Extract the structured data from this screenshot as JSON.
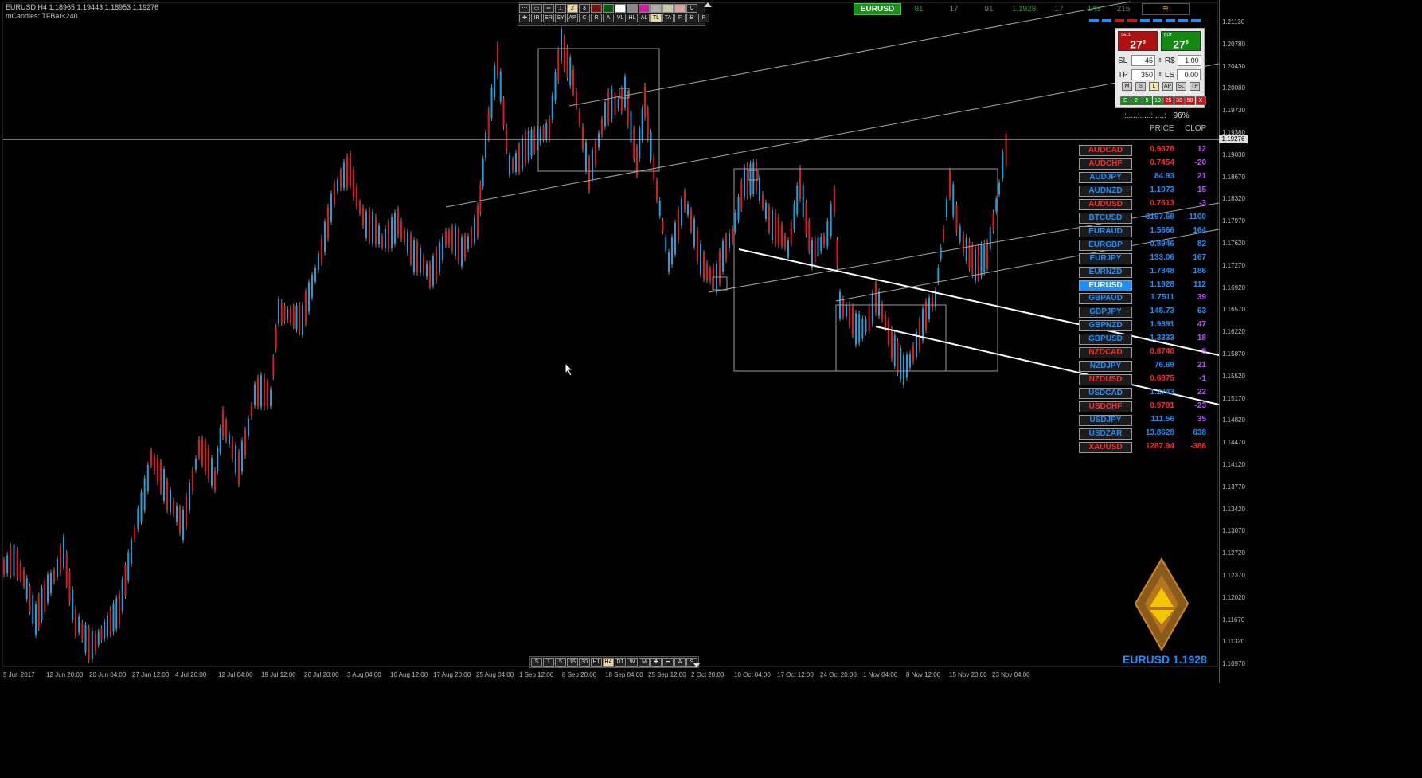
{
  "header": {
    "symbol_info": "EURUSD,H4  1.18965 1.19443 1.18953 1.19276",
    "indicator": "mCandles: TFBar<240"
  },
  "y_axis": [
    "1.21130",
    "1.20780",
    "1.20430",
    "1.20080",
    "1.19730",
    "1.19380",
    "1.19030",
    "1.18670",
    "1.18320",
    "1.17970",
    "1.17620",
    "1.17270",
    "1.16920",
    "1.16570",
    "1.16220",
    "1.15870",
    "1.15520",
    "1.15170",
    "1.14820",
    "1.14470",
    "1.14120",
    "1.13770",
    "1.13420",
    "1.13070",
    "1.12720",
    "1.12370",
    "1.12020",
    "1.11670",
    "1.11320",
    "1.10970"
  ],
  "current_price_label": "1.19276",
  "x_axis": [
    "5 Jun 2017",
    "12 Jun 20:00",
    "20 Jun 04:00",
    "27 Jun 12:00",
    "4 Jul 20:00",
    "12 Jul 04:00",
    "19 Jul 12:00",
    "26 Jul 20:00",
    "3 Aug 04:00",
    "10 Aug 12:00",
    "17 Aug 20:00",
    "25 Aug 04:00",
    "1 Sep 12:00",
    "8 Sep 20:00",
    "18 Sep 04:00",
    "25 Sep 12:00",
    "2 Oct 20:00",
    "10 Oct 04:00",
    "17 Oct 12:00",
    "24 Oct 20:00",
    "1 Nov 04:00",
    "8 Nov 12:00",
    "15 Nov 20:00",
    "23 Nov 04:00"
  ],
  "top_toolbar": {
    "row1": [
      "⋯",
      "▭",
      "═",
      "1",
      "2",
      "3"
    ],
    "row2": [
      "✚",
      "IR",
      "ER",
      "SY",
      "AP",
      "C",
      "R",
      "A",
      "VL",
      "HL",
      "AL",
      "TL",
      "TA",
      "F",
      "B",
      "P"
    ],
    "colors": [
      "#7a1010",
      "#0b5b0b",
      "#ffffff",
      "#888888",
      "#d020a0",
      "#aaaaaa",
      "#c8c8a0",
      "#d8a0a0"
    ],
    "right_btn": "C"
  },
  "bottom_toolbar": [
    "S",
    "1",
    "5",
    "15",
    "30",
    "H1",
    "H4",
    "D1",
    "W",
    "M",
    "✚",
    "━",
    "A",
    "S"
  ],
  "top_strip": {
    "pair": "EURUSD",
    "v1": "81",
    "v2": "17",
    "v3": "91",
    "v4": "1.1928",
    "v5": "17",
    "v6": "143",
    "v7": "215",
    "sym": "≋"
  },
  "trade_panel": {
    "sell_label": "SELL",
    "sell_value": "27",
    "sell_sup": "5",
    "buy_label": "BUY",
    "buy_value": "27",
    "buy_sup": "6",
    "sl_label": "SL",
    "sl_value": "45",
    "rs_label": "R$",
    "rs_value": "1.00",
    "tp_label": "TP",
    "tp_value": "350",
    "ls_label": "LS",
    "ls_value": "0.00",
    "row_btns": [
      "M",
      "S",
      "L",
      "AP",
      "SL",
      "TP"
    ],
    "close_btns": [
      "E",
      "2",
      "5",
      "10",
      "25",
      "33",
      "50",
      "X"
    ]
  },
  "progress": {
    "label": ":.....:.....:.....:",
    "value": "96%"
  },
  "pairs_header": {
    "price": "PRICE",
    "clop": "CLOP"
  },
  "pairs": [
    {
      "name": "AUDCAD",
      "price": "0.9678",
      "clop": "12",
      "color": "#ff2a2a",
      "clop_color": "#c050ff"
    },
    {
      "name": "AUDCHF",
      "price": "0.7454",
      "clop": "-20",
      "color": "#ff2a2a",
      "clop_color": "#c050ff"
    },
    {
      "name": "AUDJPY",
      "price": "84.93",
      "clop": "21",
      "color": "#1e8fff",
      "clop_color": "#c050ff"
    },
    {
      "name": "AUDNZD",
      "price": "1.1073",
      "clop": "15",
      "color": "#1e8fff",
      "clop_color": "#c050ff"
    },
    {
      "name": "AUDUSD",
      "price": "0.7613",
      "clop": "-3",
      "color": "#ff2a2a",
      "clop_color": "#c050ff"
    },
    {
      "name": "BTCUSD",
      "price": "8197.68",
      "clop": "1100",
      "color": "#1e8fff",
      "clop_color": "#1e8fff"
    },
    {
      "name": "EURAUD",
      "price": "1.5666",
      "clop": "164",
      "color": "#1e8fff",
      "clop_color": "#1e8fff"
    },
    {
      "name": "EURGBP",
      "price": "0.8946",
      "clop": "82",
      "color": "#1e8fff",
      "clop_color": "#1e8fff"
    },
    {
      "name": "EURJPY",
      "price": "133.06",
      "clop": "167",
      "color": "#1e8fff",
      "clop_color": "#1e8fff"
    },
    {
      "name": "EURNZD",
      "price": "1.7348",
      "clop": "186",
      "color": "#1e8fff",
      "clop_color": "#1e8fff"
    },
    {
      "name": "EURUSD",
      "price": "1.1928",
      "clop": "112",
      "color": "#1e8fff",
      "clop_color": "#1e8fff",
      "active": true
    },
    {
      "name": "GBPAUD",
      "price": "1.7511",
      "clop": "39",
      "color": "#1e8fff",
      "clop_color": "#c050ff"
    },
    {
      "name": "GBPJPY",
      "price": "148.73",
      "clop": "63",
      "color": "#1e8fff",
      "clop_color": "#1e8fff"
    },
    {
      "name": "GBPNZD",
      "price": "1.9391",
      "clop": "47",
      "color": "#1e8fff",
      "clop_color": "#c050ff"
    },
    {
      "name": "GBPUSD",
      "price": "1.3333",
      "clop": "18",
      "color": "#1e8fff",
      "clop_color": "#c050ff"
    },
    {
      "name": "NZDCAD",
      "price": "0.8740",
      "clop": "9",
      "color": "#ff2a2a",
      "clop_color": "#c050ff"
    },
    {
      "name": "NZDJPY",
      "price": "76.69",
      "clop": "21",
      "color": "#1e8fff",
      "clop_color": "#c050ff"
    },
    {
      "name": "NZDUSD",
      "price": "0.6875",
      "clop": "-1",
      "color": "#ff2a2a",
      "clop_color": "#c050ff"
    },
    {
      "name": "USDCAD",
      "price": "1.2743",
      "clop": "22",
      "color": "#1e8fff",
      "clop_color": "#c050ff"
    },
    {
      "name": "USDCHF",
      "price": "0.9791",
      "clop": "-23",
      "color": "#ff2a2a",
      "clop_color": "#c050ff"
    },
    {
      "name": "USDJPY",
      "price": "111.56",
      "clop": "35",
      "color": "#1e8fff",
      "clop_color": "#c050ff"
    },
    {
      "name": "USDZAR",
      "price": "13.8628",
      "clop": "638",
      "color": "#1e8fff",
      "clop_color": "#1e8fff"
    },
    {
      "name": "XAUUSD",
      "price": "1287.94",
      "clop": "-386",
      "color": "#ff2a2a",
      "clop_color": "#ff2a2a"
    }
  ],
  "brand": {
    "text": "EURUSD 1.1928"
  }
}
